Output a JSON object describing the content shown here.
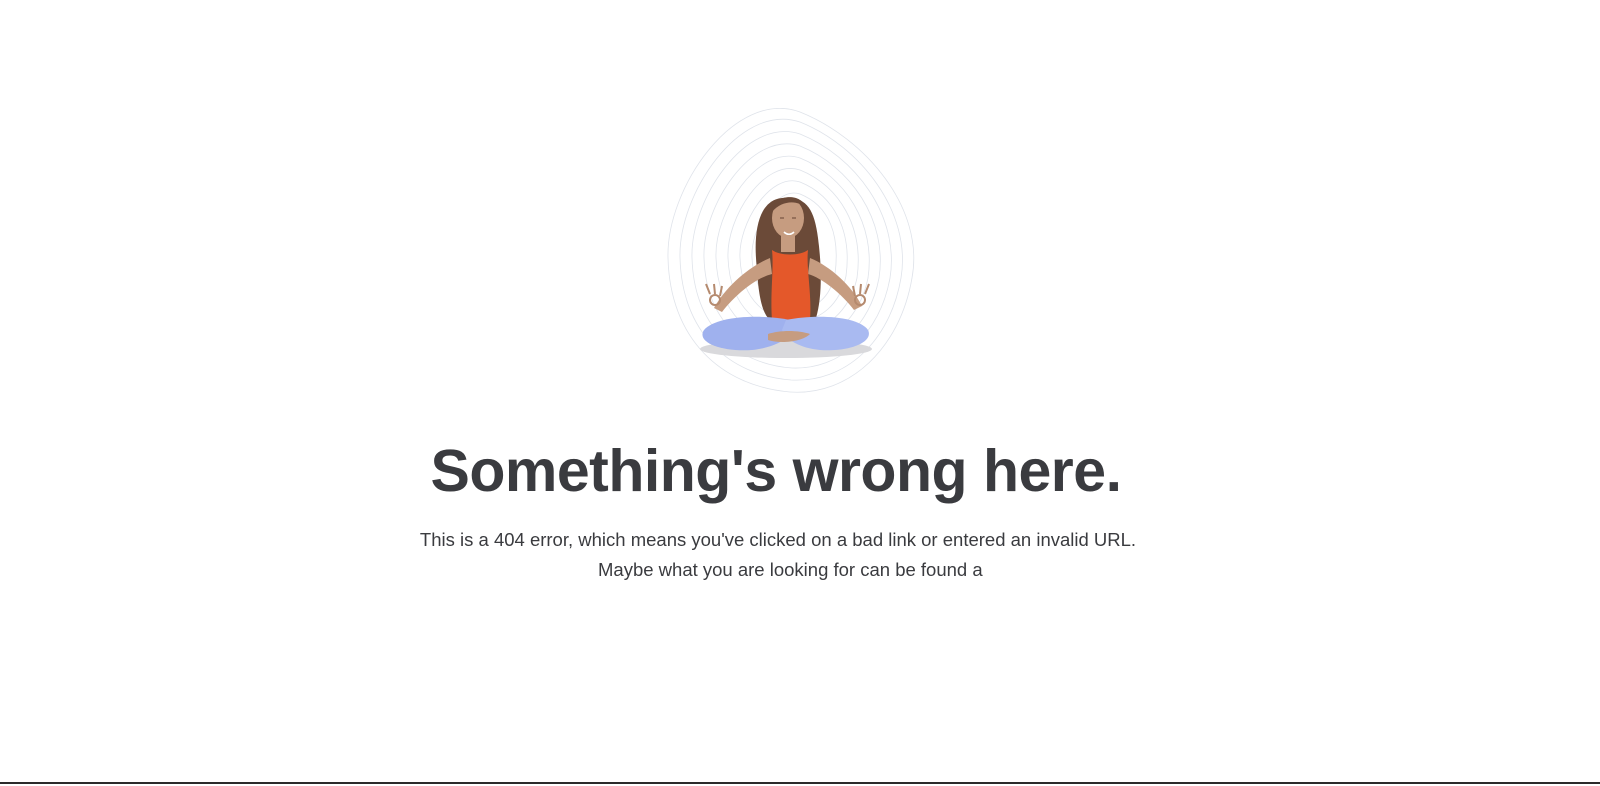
{
  "error_page": {
    "illustration": "meditating-woman-illustration",
    "headline": "Something's wrong here.",
    "description_line1": "This is a 404 error, which means you've clicked on a bad link or entered an invalid URL.",
    "description_line2": "Maybe what you are looking for can be found a"
  },
  "colors": {
    "text": "#3a3b3f",
    "tank_top": "#e4582a",
    "pants": "#9fb1ee",
    "skin": "#c69c80",
    "hair": "#6b4a38",
    "contour_lines": "#dfe3ea"
  }
}
